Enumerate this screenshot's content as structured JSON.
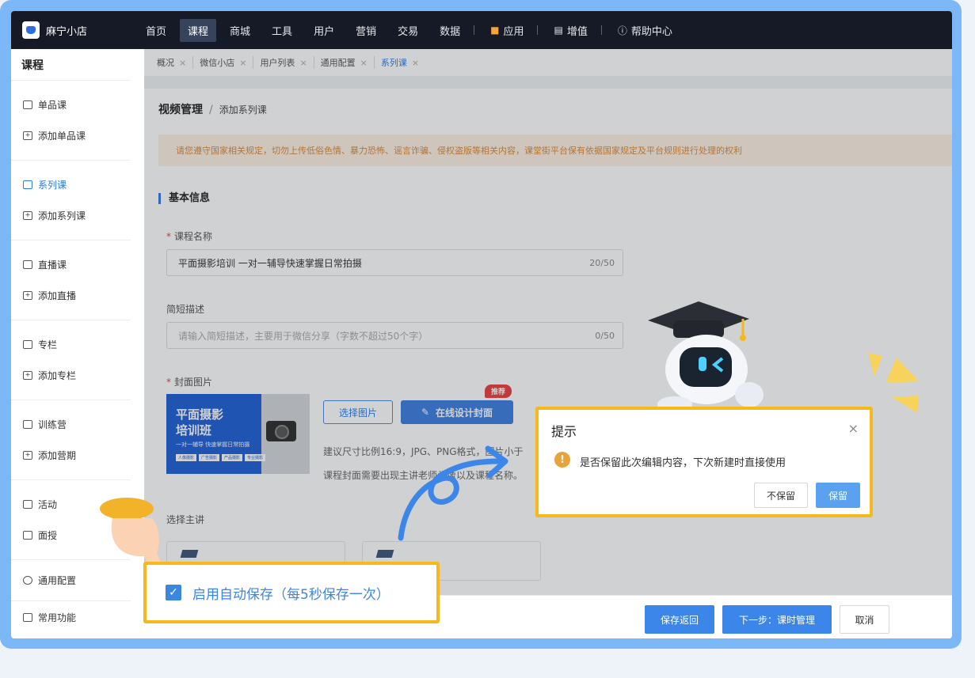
{
  "app": {
    "name": "麻宁小店"
  },
  "topnav": {
    "items": [
      {
        "label": "首页"
      },
      {
        "label": "课程",
        "active": true
      },
      {
        "label": "商城"
      },
      {
        "label": "工具"
      },
      {
        "label": "用户"
      },
      {
        "label": "营销"
      },
      {
        "label": "交易"
      },
      {
        "label": "数据"
      },
      {
        "label": "应用",
        "icon": "cube-icon"
      },
      {
        "label": "增值",
        "icon": "chart-icon"
      },
      {
        "label": "帮助中心",
        "icon": "help-icon"
      }
    ]
  },
  "sidebar": {
    "title": "课程",
    "items": [
      {
        "label": "单品课",
        "icon": "single-course-icon"
      },
      {
        "label": "添加单品课",
        "icon": "add-course-icon"
      },
      {
        "label": "系列课",
        "icon": "series-icon",
        "active": true
      },
      {
        "label": "添加系列课",
        "icon": "add-series-icon"
      },
      {
        "label": "直播课",
        "icon": "live-icon"
      },
      {
        "label": "添加直播",
        "icon": "add-live-icon"
      },
      {
        "label": "专栏",
        "icon": "column-icon"
      },
      {
        "label": "添加专栏",
        "icon": "add-column-icon"
      },
      {
        "label": "训练营",
        "icon": "camp-icon"
      },
      {
        "label": "添加营期",
        "icon": "add-camp-icon"
      },
      {
        "label": "活动",
        "icon": "activity-icon"
      },
      {
        "label": "面授",
        "icon": "offline-icon"
      },
      {
        "label": "通用配置",
        "icon": "settings-icon"
      },
      {
        "label": "常用功能",
        "icon": "grid-icon"
      }
    ]
  },
  "tabs": [
    {
      "label": "概况"
    },
    {
      "label": "微信小店"
    },
    {
      "label": "用户列表"
    },
    {
      "label": "通用配置"
    },
    {
      "label": "系列课",
      "active": true
    }
  ],
  "page": {
    "breadcrumb_root": "视频管理",
    "breadcrumb_sep": "/",
    "breadcrumb_current": "添加系列课",
    "notice": "请您遵守国家相关规定，切勿上传低俗色情、暴力恐怖、谣言诈骗、侵权盗版等相关内容，课堂街平台保有依据国家规定及平台规则进行处理的权利",
    "section_title": "基本信息",
    "course_name_label": "课程名称",
    "course_name_value": "平面摄影培训 一对一辅导快速掌握日常拍摄",
    "course_name_count": "20/50",
    "desc_label": "简短描述",
    "desc_placeholder": "请输入简短描述，主要用于微信分享（字数不超过50个字）",
    "desc_count": "0/50",
    "cover_label": "封面图片",
    "cover_title_line1": "平面摄影",
    "cover_title_line2": "培训班",
    "cover_subtitle": "一对一辅导 快速掌握日常拍摄",
    "cover_tags": [
      "人像摄影",
      "广告摄影",
      "产品摄影",
      "专业摄影"
    ],
    "select_image_button": "选择图片",
    "design_cover_button": "在线设计封面",
    "recommend_badge": "推荐",
    "hint_line1": "建议尺寸比例16:9，JPG、PNG格式，图片小于",
    "hint_line2": "课程封面需要出现主讲老师头像以及课程名称。",
    "teacher_label": "选择主讲"
  },
  "footer": {
    "save_back": "保存返回",
    "next_step": "下一步：课时管理",
    "cancel": "取消"
  },
  "dialog": {
    "title": "提示",
    "message": "是否保留此次编辑内容，下次新建时直接使用",
    "discard": "不保留",
    "keep": "保留"
  },
  "autosave": {
    "label": "启用自动保存（每5秒保存一次）",
    "checked": true
  },
  "colors": {
    "accent": "#2c7be5",
    "highlight_border": "#f7b81c",
    "nav_bg": "#151a26",
    "frame": "#7cb8f8"
  }
}
